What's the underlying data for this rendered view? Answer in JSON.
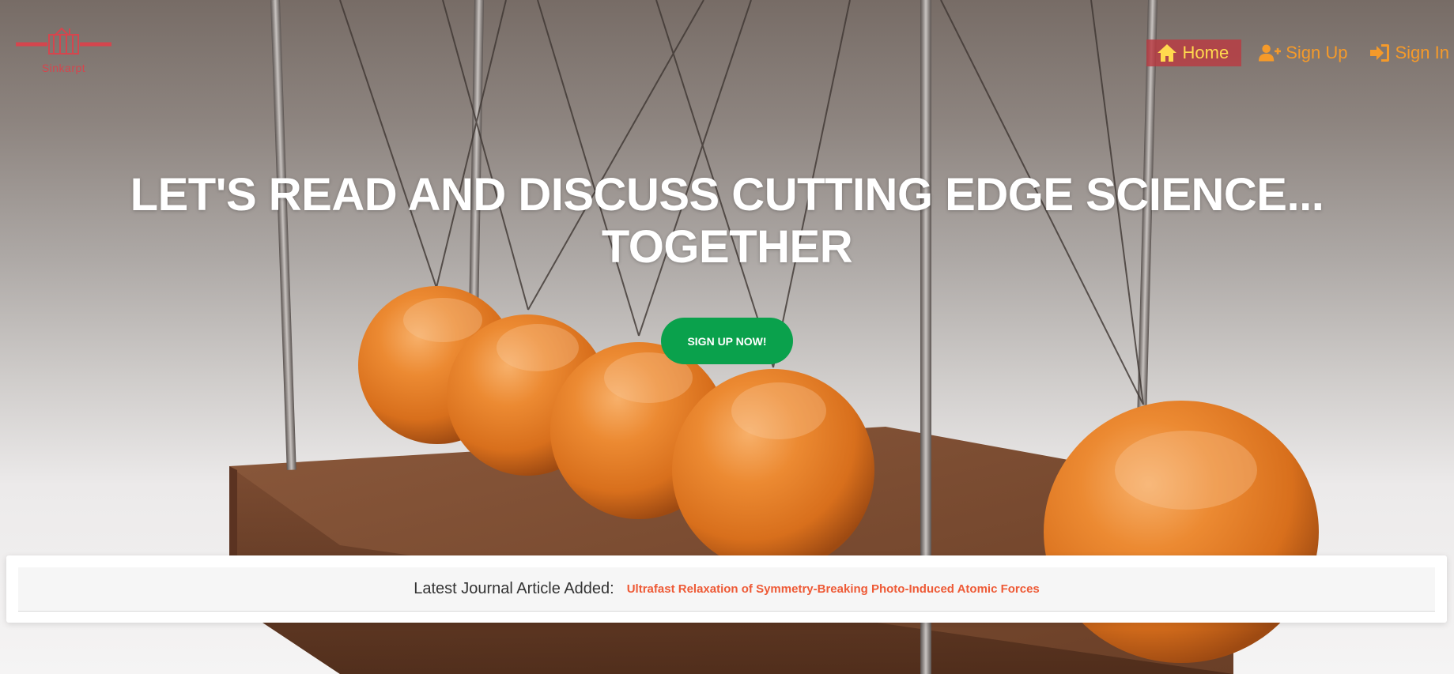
{
  "brand": {
    "logo_caption": "Sinkarpt",
    "logo_color": "#d4464e"
  },
  "nav": {
    "items": [
      {
        "label": "Home",
        "icon": "home-icon",
        "active": true
      },
      {
        "label": "Sign Up",
        "icon": "user-plus-icon",
        "active": false
      },
      {
        "label": "Sign In",
        "icon": "sign-in-icon",
        "active": false
      }
    ],
    "active_bg": "#b93a42",
    "active_color": "#ffd94e",
    "color": "#f59a2a"
  },
  "hero": {
    "headline_line1": "LET'S READ AND DISCUSS CUTTING EDGE SCIENCE...",
    "headline_line2": "TOGETHER",
    "cta_label": "SIGN UP NOW!",
    "cta_color": "#0aa14c",
    "image_subject": "newtons-cradle-orange-balls"
  },
  "latest": {
    "label": "Latest Journal Article Added:",
    "article_title": "Ultrafast Relaxation of Symmetry-Breaking Photo-Induced Atomic Forces",
    "link_color": "#ee5a36"
  }
}
